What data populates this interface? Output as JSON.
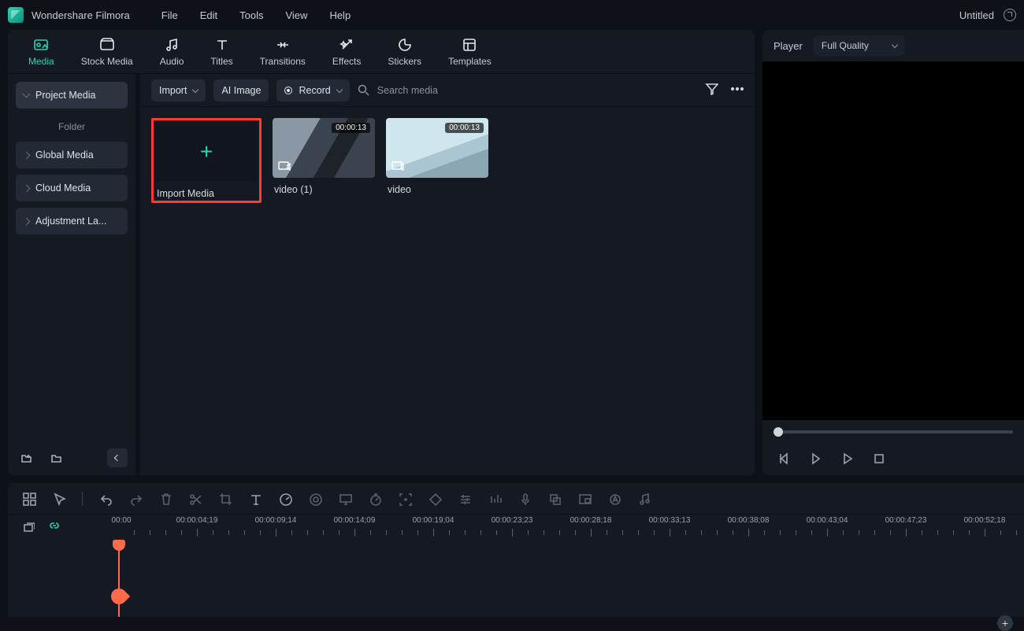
{
  "app": {
    "name": "Wondershare Filmora",
    "doc_title": "Untitled"
  },
  "menu": {
    "file": "File",
    "edit": "Edit",
    "tools": "Tools",
    "view": "View",
    "help": "Help"
  },
  "tabs": {
    "media": "Media",
    "stock": "Stock Media",
    "audio": "Audio",
    "titles": "Titles",
    "transitions": "Transitions",
    "effects": "Effects",
    "stickers": "Stickers",
    "templates": "Templates"
  },
  "sidebar": {
    "project_media": "Project Media",
    "folder": "Folder",
    "global": "Global Media",
    "cloud": "Cloud Media",
    "adjustment": "Adjustment La..."
  },
  "toolbar": {
    "import": "Import",
    "ai_image": "AI Image",
    "record": "Record",
    "search_placeholder": "Search media"
  },
  "media": {
    "import_label": "Import Media",
    "items": [
      {
        "name": "video (1)",
        "duration": "00:00:13"
      },
      {
        "name": "video",
        "duration": "00:00:13"
      }
    ]
  },
  "player": {
    "label": "Player",
    "quality": "Full Quality"
  },
  "timeline": {
    "start": "00:00",
    "labels": [
      "00:00:04;19",
      "00:00:09;14",
      "00:00:14;09",
      "00:00:19;04",
      "00:00:23;23",
      "00:00:28;18",
      "00:00:33;13",
      "00:00:38;08",
      "00:00:43;04",
      "00:00:47;23",
      "00:00:52;18"
    ]
  }
}
